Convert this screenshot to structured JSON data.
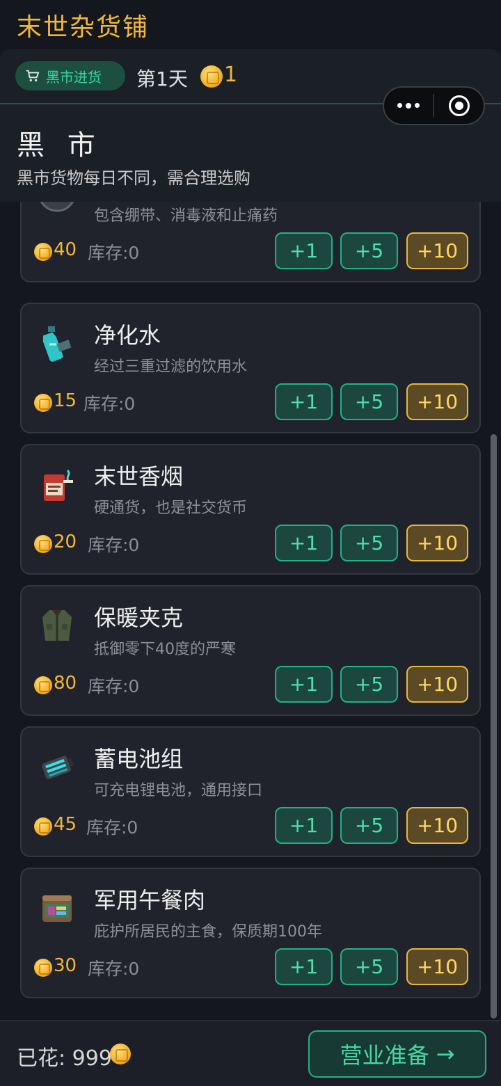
{
  "app": {
    "title": "末世杂货铺"
  },
  "header": {
    "tab_label": "黑市进货",
    "day_label": "第1天",
    "coins": "1",
    "section_title": "黑 市",
    "section_subtitle": "黑市货物每日不同，需合理选购"
  },
  "buttons": {
    "plus1": "+1",
    "plus5": "+5",
    "plus10": "+10"
  },
  "items": [
    {
      "name": "",
      "desc": "包含绷带、消毒液和止痛药",
      "price": "40",
      "stock": "库存:0",
      "icon": "first-aid-kit-icon"
    },
    {
      "name": "净化水",
      "desc": "经过三重过滤的饮用水",
      "price": "15",
      "stock": "库存:0",
      "icon": "water-bottle-icon"
    },
    {
      "name": "末世香烟",
      "desc": "硬通货，也是社交货币",
      "price": "20",
      "stock": "库存:0",
      "icon": "cigarette-pack-icon"
    },
    {
      "name": "保暖夹克",
      "desc": "抵御零下40度的严寒",
      "price": "80",
      "stock": "库存:0",
      "icon": "jacket-icon"
    },
    {
      "name": "蓄电池组",
      "desc": "可充电锂电池，通用接口",
      "price": "45",
      "stock": "库存:0",
      "icon": "battery-pack-icon"
    },
    {
      "name": "军用午餐肉",
      "desc": "庇护所居民的主食，保质期100年",
      "price": "30",
      "stock": "库存:0",
      "icon": "canned-meat-icon"
    }
  ],
  "footer": {
    "spent_label": "已花: 999",
    "ready_label": "营业准备",
    "ready_arrow": "→"
  },
  "colors": {
    "gold": "#f3b73a",
    "green": "#1fb384",
    "background": "#14171d",
    "card": "#20232c"
  }
}
